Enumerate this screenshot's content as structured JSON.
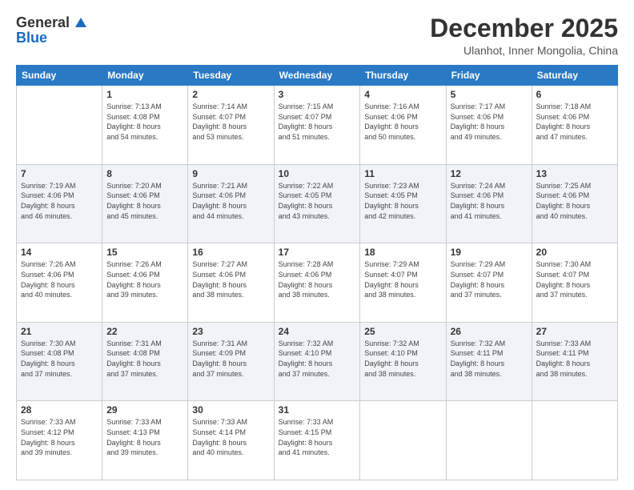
{
  "header": {
    "logo_general": "General",
    "logo_blue": "Blue",
    "title": "December 2025",
    "subtitle": "Ulanhot, Inner Mongolia, China"
  },
  "weekdays": [
    "Sunday",
    "Monday",
    "Tuesday",
    "Wednesday",
    "Thursday",
    "Friday",
    "Saturday"
  ],
  "weeks": [
    {
      "shaded": false,
      "days": [
        {
          "num": "",
          "detail": ""
        },
        {
          "num": "1",
          "detail": "Sunrise: 7:13 AM\nSunset: 4:08 PM\nDaylight: 8 hours\nand 54 minutes."
        },
        {
          "num": "2",
          "detail": "Sunrise: 7:14 AM\nSunset: 4:07 PM\nDaylight: 8 hours\nand 53 minutes."
        },
        {
          "num": "3",
          "detail": "Sunrise: 7:15 AM\nSunset: 4:07 PM\nDaylight: 8 hours\nand 51 minutes."
        },
        {
          "num": "4",
          "detail": "Sunrise: 7:16 AM\nSunset: 4:06 PM\nDaylight: 8 hours\nand 50 minutes."
        },
        {
          "num": "5",
          "detail": "Sunrise: 7:17 AM\nSunset: 4:06 PM\nDaylight: 8 hours\nand 49 minutes."
        },
        {
          "num": "6",
          "detail": "Sunrise: 7:18 AM\nSunset: 4:06 PM\nDaylight: 8 hours\nand 47 minutes."
        }
      ]
    },
    {
      "shaded": true,
      "days": [
        {
          "num": "7",
          "detail": "Sunrise: 7:19 AM\nSunset: 4:06 PM\nDaylight: 8 hours\nand 46 minutes."
        },
        {
          "num": "8",
          "detail": "Sunrise: 7:20 AM\nSunset: 4:06 PM\nDaylight: 8 hours\nand 45 minutes."
        },
        {
          "num": "9",
          "detail": "Sunrise: 7:21 AM\nSunset: 4:06 PM\nDaylight: 8 hours\nand 44 minutes."
        },
        {
          "num": "10",
          "detail": "Sunrise: 7:22 AM\nSunset: 4:05 PM\nDaylight: 8 hours\nand 43 minutes."
        },
        {
          "num": "11",
          "detail": "Sunrise: 7:23 AM\nSunset: 4:05 PM\nDaylight: 8 hours\nand 42 minutes."
        },
        {
          "num": "12",
          "detail": "Sunrise: 7:24 AM\nSunset: 4:06 PM\nDaylight: 8 hours\nand 41 minutes."
        },
        {
          "num": "13",
          "detail": "Sunrise: 7:25 AM\nSunset: 4:06 PM\nDaylight: 8 hours\nand 40 minutes."
        }
      ]
    },
    {
      "shaded": false,
      "days": [
        {
          "num": "14",
          "detail": "Sunrise: 7:26 AM\nSunset: 4:06 PM\nDaylight: 8 hours\nand 40 minutes."
        },
        {
          "num": "15",
          "detail": "Sunrise: 7:26 AM\nSunset: 4:06 PM\nDaylight: 8 hours\nand 39 minutes."
        },
        {
          "num": "16",
          "detail": "Sunrise: 7:27 AM\nSunset: 4:06 PM\nDaylight: 8 hours\nand 38 minutes."
        },
        {
          "num": "17",
          "detail": "Sunrise: 7:28 AM\nSunset: 4:06 PM\nDaylight: 8 hours\nand 38 minutes."
        },
        {
          "num": "18",
          "detail": "Sunrise: 7:29 AM\nSunset: 4:07 PM\nDaylight: 8 hours\nand 38 minutes."
        },
        {
          "num": "19",
          "detail": "Sunrise: 7:29 AM\nSunset: 4:07 PM\nDaylight: 8 hours\nand 37 minutes."
        },
        {
          "num": "20",
          "detail": "Sunrise: 7:30 AM\nSunset: 4:07 PM\nDaylight: 8 hours\nand 37 minutes."
        }
      ]
    },
    {
      "shaded": true,
      "days": [
        {
          "num": "21",
          "detail": "Sunrise: 7:30 AM\nSunset: 4:08 PM\nDaylight: 8 hours\nand 37 minutes."
        },
        {
          "num": "22",
          "detail": "Sunrise: 7:31 AM\nSunset: 4:08 PM\nDaylight: 8 hours\nand 37 minutes."
        },
        {
          "num": "23",
          "detail": "Sunrise: 7:31 AM\nSunset: 4:09 PM\nDaylight: 8 hours\nand 37 minutes."
        },
        {
          "num": "24",
          "detail": "Sunrise: 7:32 AM\nSunset: 4:10 PM\nDaylight: 8 hours\nand 37 minutes."
        },
        {
          "num": "25",
          "detail": "Sunrise: 7:32 AM\nSunset: 4:10 PM\nDaylight: 8 hours\nand 38 minutes."
        },
        {
          "num": "26",
          "detail": "Sunrise: 7:32 AM\nSunset: 4:11 PM\nDaylight: 8 hours\nand 38 minutes."
        },
        {
          "num": "27",
          "detail": "Sunrise: 7:33 AM\nSunset: 4:11 PM\nDaylight: 8 hours\nand 38 minutes."
        }
      ]
    },
    {
      "shaded": false,
      "days": [
        {
          "num": "28",
          "detail": "Sunrise: 7:33 AM\nSunset: 4:12 PM\nDaylight: 8 hours\nand 39 minutes."
        },
        {
          "num": "29",
          "detail": "Sunrise: 7:33 AM\nSunset: 4:13 PM\nDaylight: 8 hours\nand 39 minutes."
        },
        {
          "num": "30",
          "detail": "Sunrise: 7:33 AM\nSunset: 4:14 PM\nDaylight: 8 hours\nand 40 minutes."
        },
        {
          "num": "31",
          "detail": "Sunrise: 7:33 AM\nSunset: 4:15 PM\nDaylight: 8 hours\nand 41 minutes."
        },
        {
          "num": "",
          "detail": ""
        },
        {
          "num": "",
          "detail": ""
        },
        {
          "num": "",
          "detail": ""
        }
      ]
    }
  ]
}
